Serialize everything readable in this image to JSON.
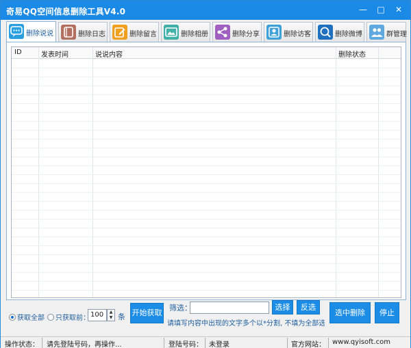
{
  "window": {
    "title": "奇易QQ空间信息删除工具V4.0",
    "controls": {
      "minimize": "—",
      "maximize": "□",
      "close": "✕"
    }
  },
  "tabs": [
    {
      "label": "删除说说",
      "icon": "chat-bubble-icon",
      "color": "#2a9fe0",
      "active": true
    },
    {
      "label": "删除日志",
      "icon": "journal-icon",
      "color": "#b27060"
    },
    {
      "label": "删除留言",
      "icon": "edit-note-icon",
      "color": "#f0a020"
    },
    {
      "label": "删除相册",
      "icon": "image-gallery-icon",
      "color": "#40b0a8"
    },
    {
      "label": "删除分享",
      "icon": "share-icon",
      "color": "#a060c0"
    },
    {
      "label": "删除访客",
      "icon": "visitor-icon",
      "color": "#40a0d8"
    },
    {
      "label": "删除微博",
      "icon": "weibo-icon",
      "color": "#2070c0"
    },
    {
      "label": "群管理",
      "icon": "group-users-icon",
      "color": "#60a8e0"
    }
  ],
  "table": {
    "columns": [
      "ID",
      "发表时间",
      "说说内容",
      "删除状态"
    ],
    "rows": []
  },
  "controls": {
    "fetch_all": "获取全部",
    "fetch_first": "只获取前：",
    "count_value": "100",
    "count_unit": "条",
    "start_fetch": "开始获取",
    "filter_label": "筛选：",
    "filter_value": "",
    "select": "选择",
    "invert": "反选",
    "hint": "请填写内容中出现的文字多个以*分割, 不填为全部选择",
    "delete_selected": "选中删除",
    "stop": "停止"
  },
  "status": {
    "op_label": "操作状态：",
    "op_value": "请先登陆号码，再操作...",
    "login_label": "登陆号码：",
    "login_value": "未登录",
    "site_label": "官方网站：",
    "site_value": "www.qyisoft.com"
  },
  "colors": {
    "titlebar": "#1a8ae6",
    "button": "#1c8de6",
    "accent_text": "#2060a0"
  }
}
